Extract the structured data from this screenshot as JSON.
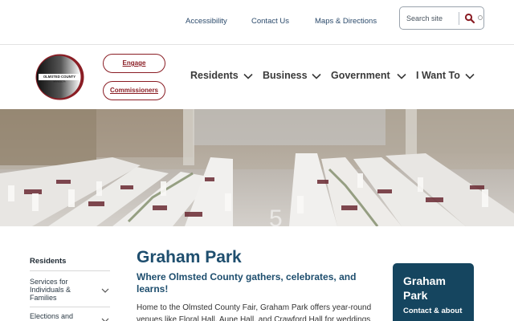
{
  "utility": {
    "links": [
      "Accessibility",
      "Contact Us",
      "Maps & Directions"
    ],
    "search_placeholder": "Search site"
  },
  "header": {
    "logo_text_1": "OLMSTED COUNTY",
    "logo_text_2": "MINNESOTA",
    "engage_label": "Engage",
    "commissioners_label": "Commissioners",
    "nav": [
      "Residents",
      "Business",
      "Government",
      "I Want To"
    ]
  },
  "sidebar": {
    "title": "Residents",
    "items": [
      "Services for Individuals & Families",
      "Elections and"
    ]
  },
  "main": {
    "title": "Graham Park",
    "tagline": "Where Olmsted County gathers, celebrates, and learns!",
    "body": "Home to the Olmsted County Fair, Graham Park offers year-round venues like Floral Hall, Aune Hall, and Crawford Hall for weddings"
  },
  "card": {
    "title": "Graham Park",
    "subtitle": "Contact & about"
  },
  "colors": {
    "brand_red": "#8a1d24",
    "brand_blue": "#1e4e6e",
    "card_bg": "#15455f"
  }
}
